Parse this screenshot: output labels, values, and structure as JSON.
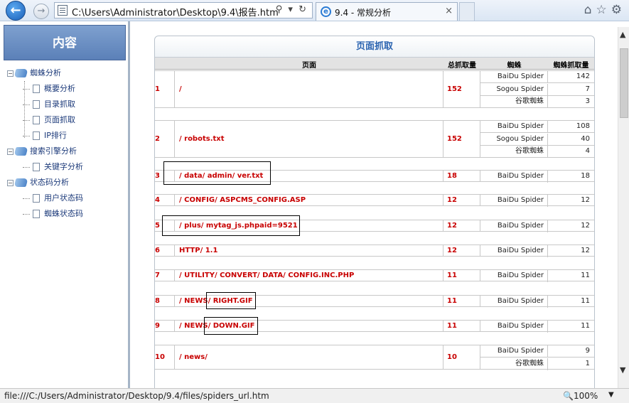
{
  "browser": {
    "address_url": "C:\\Users\\Administrator\\Desktop\\9.4\\报告.htm",
    "address_icons": "⚲ ▾ ↻",
    "tab_title": "9.4 - 常规分析",
    "tab_close": "×",
    "back_glyph": "←",
    "forward_glyph": "→",
    "toolbar_icons": {
      "home": "⌂",
      "favorites": "☆",
      "settings": "⚙"
    }
  },
  "sidebar": {
    "title": "内容",
    "groups": [
      {
        "label": "蜘蛛分析",
        "items": [
          "概要分析",
          "目录抓取",
          "页面抓取",
          "IP排行"
        ]
      },
      {
        "label": "搜索引擎分析",
        "items": [
          "关键字分析"
        ]
      },
      {
        "label": "状态码分析",
        "items": [
          "用户状态码",
          "蜘蛛状态码"
        ]
      }
    ]
  },
  "report": {
    "title": "页面抓取",
    "headers": {
      "page": "页面",
      "total": "总抓取量",
      "spider": "蜘蛛",
      "spider_count": "蜘蛛抓取量"
    },
    "rows": [
      {
        "num": "1",
        "page": "/",
        "total": "152",
        "spiders": [
          {
            "name": "BaiDu Spider",
            "count": "142"
          },
          {
            "name": "Sogou Spider",
            "count": "7"
          },
          {
            "name": "谷歌蜘蛛",
            "count": "3"
          }
        ]
      },
      {
        "num": "2",
        "page": "/ robots.txt",
        "total": "152",
        "spiders": [
          {
            "name": "BaiDu Spider",
            "count": "108"
          },
          {
            "name": "Sogou Spider",
            "count": "40"
          },
          {
            "name": "谷歌蜘蛛",
            "count": "4"
          }
        ]
      },
      {
        "num": "3",
        "page": "/ data/ admin/ ver.txt",
        "total": "18",
        "spiders": [
          {
            "name": "BaiDu Spider",
            "count": "18"
          }
        ]
      },
      {
        "num": "4",
        "page": "/ CONFIG/ ASPCMS_CONFIG.ASP",
        "total": "12",
        "spiders": [
          {
            "name": "BaiDu Spider",
            "count": "12"
          }
        ]
      },
      {
        "num": "5",
        "page": "/ plus/ mytag_js.phpaid=9521",
        "total": "12",
        "spiders": [
          {
            "name": "BaiDu Spider",
            "count": "12"
          }
        ]
      },
      {
        "num": "6",
        "page": "HTTP/ 1.1",
        "total": "12",
        "spiders": [
          {
            "name": "BaiDu Spider",
            "count": "12"
          }
        ]
      },
      {
        "num": "7",
        "page": "/ UTILITY/ CONVERT/ DATA/ CONFIG.INC.PHP",
        "total": "11",
        "spiders": [
          {
            "name": "BaiDu Spider",
            "count": "11"
          }
        ]
      },
      {
        "num": "8",
        "page": "/ NEWS/ RIGHT.GIF",
        "total": "11",
        "spiders": [
          {
            "name": "BaiDu Spider",
            "count": "11"
          }
        ]
      },
      {
        "num": "9",
        "page": "/ NEWS/ DOWN.GIF",
        "total": "11",
        "spiders": [
          {
            "name": "BaiDu Spider",
            "count": "11"
          }
        ]
      },
      {
        "num": "10",
        "page": "/ news/",
        "total": "10",
        "spiders": [
          {
            "name": "BaiDu Spider",
            "count": "9"
          },
          {
            "name": "谷歌蜘蛛",
            "count": "1"
          }
        ]
      }
    ]
  },
  "status_bar": {
    "url": "file:///C:/Users/Administrator/Desktop/9.4/files/spiders_url.htm",
    "zoom": "🔍100%",
    "zoom_dropdown": "▼"
  }
}
